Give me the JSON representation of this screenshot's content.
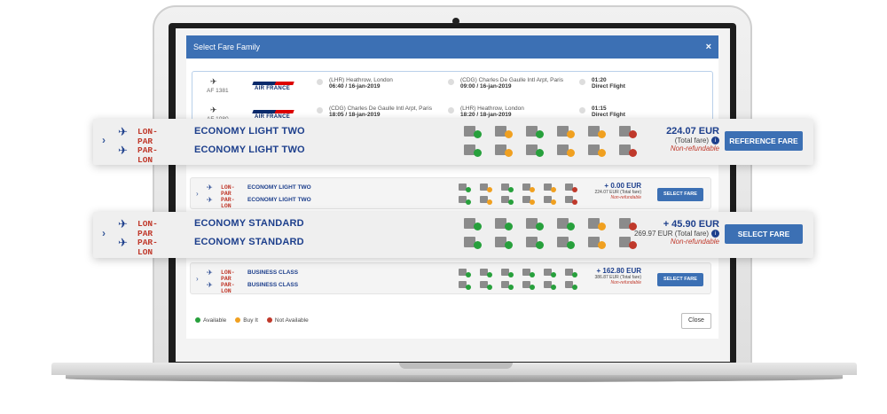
{
  "modal": {
    "title": "Select Fare Family",
    "close_icon": "×",
    "close_button": "Close"
  },
  "flights": [
    {
      "plane_icon": "✈",
      "flight_no": "AF 1381",
      "airline_logo": "AIR FRANCE",
      "origin": "(LHR) Heathrow, London",
      "departure": "06:40 / 16-jan-2019",
      "destination": "(CDG) Charles De Gaulle Intl Arpt, Paris",
      "arrival": "09:00 / 16-jan-2019",
      "duration": "01:20",
      "type": "Direct Flight"
    },
    {
      "plane_icon": "✈",
      "flight_no": "AF 1080",
      "airline_logo": "AIR FRANCE",
      "origin": "(CDG) Charles De Gaulle Intl Arpt, Paris",
      "departure": "18:05 / 18-jan-2019",
      "destination": "(LHR) Heathrow, London",
      "arrival": "18:20 / 18-jan-2019",
      "duration": "01:15",
      "type": "Direct Flight"
    }
  ],
  "fares_small": [
    {
      "out_route": "LON-PAR",
      "out_family": "ECONOMY LIGHT TWO",
      "in_route": "PAR-LON",
      "in_family": "ECONOMY LIGHT TWO",
      "price": "+ 0.00 EUR",
      "total": "224.07 EUR (Total fare)",
      "refund": "Non-refundable",
      "button": "SELECT FARE"
    },
    {
      "out_route": "LON-PAR",
      "out_family": "BUSINESS CLASS",
      "in_route": "PAR-LON",
      "in_family": "BUSINESS CLASS",
      "price": "+ 162.80 EUR",
      "total": "386.87 EUR (Total fare)",
      "refund": "Non-refundable",
      "button": "SELECT FARE"
    }
  ],
  "cards": [
    {
      "chevron": "›",
      "out_route": "LON-PAR",
      "out_family": "ECONOMY LIGHT TWO",
      "in_route": "PAR-LON",
      "in_family": "ECONOMY LIGHT TWO",
      "price": "224.07 EUR",
      "total": "(Total fare)",
      "info_icon": "i",
      "refund": "Non-refundable",
      "button": "REFERENCE FARE",
      "out_icons": [
        "ok",
        "buy",
        "ok",
        "buy",
        "buy",
        "no"
      ],
      "in_icons": [
        "ok",
        "buy",
        "ok",
        "buy",
        "buy",
        "no"
      ]
    },
    {
      "chevron": "›",
      "out_route": "LON-PAR",
      "out_family": "ECONOMY STANDARD",
      "in_route": "PAR-LON",
      "in_family": "ECONOMY STANDARD",
      "price": "+ 45.90 EUR",
      "total": "269.97 EUR (Total fare)",
      "info_icon": "i",
      "refund": "Non-refundable",
      "button": "SELECT FARE",
      "out_icons": [
        "ok",
        "ok",
        "ok",
        "ok",
        "buy",
        "no"
      ],
      "in_icons": [
        "ok",
        "ok",
        "ok",
        "ok",
        "buy",
        "no"
      ]
    }
  ],
  "icon_names": [
    "baggage-icon",
    "refund-icon",
    "change-icon",
    "seat-icon",
    "upgrade-icon",
    "lounge-icon"
  ],
  "legend": {
    "available": "Available",
    "buy": "Buy It",
    "not_available": "Not Available"
  },
  "colors": {
    "header_blue": "#3c70b4",
    "navy": "#1d3f8c",
    "red": "#c0392b",
    "available_green": "#27a03c",
    "buy_orange": "#f0a020"
  }
}
